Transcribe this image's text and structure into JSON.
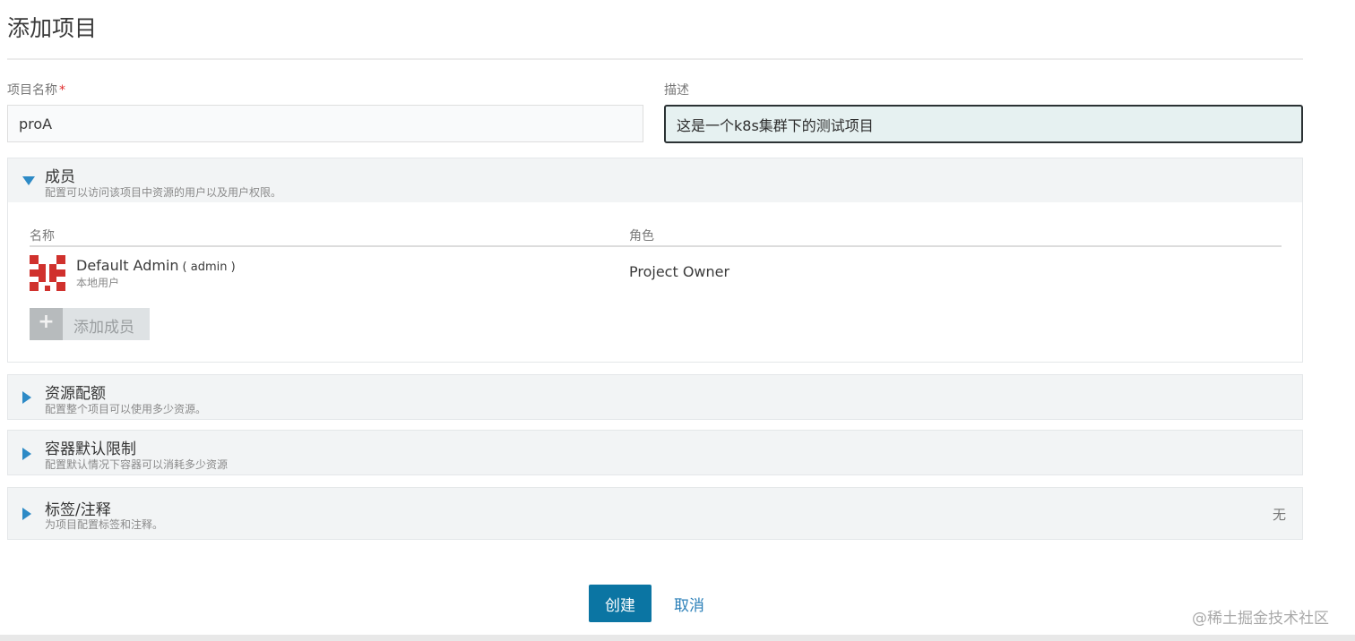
{
  "page": {
    "title": "添加项目"
  },
  "form": {
    "name_label": "项目名称",
    "required_mark": "*",
    "name_value": "proA",
    "desc_label": "描述",
    "desc_value": "这是一个k8s集群下的测试项目"
  },
  "members_section": {
    "title": "成员",
    "subtitle": "配置可以访问该项目中资源的用户以及用户权限。",
    "columns": {
      "name": "名称",
      "role": "角色"
    },
    "members": [
      {
        "display_name": "Default Admin",
        "username": "( admin )",
        "type": "本地用户",
        "role": "Project Owner"
      }
    ],
    "add_button_icon": "+",
    "add_button_label": "添加成员"
  },
  "quota_section": {
    "title": "资源配额",
    "subtitle": "配置整个项目可以使用多少资源。"
  },
  "container_limits_section": {
    "title": "容器默认限制",
    "subtitle": "配置默认情况下容器可以消耗多少资源"
  },
  "labels_section": {
    "title": "标签/注释",
    "subtitle": "为项目配置标签和注释。",
    "status": "无"
  },
  "actions": {
    "create_label": "创建",
    "cancel_label": "取消"
  },
  "watermark": "@稀土掘金技术社区",
  "colors": {
    "accent": "#0b75a3",
    "caret": "#2d8ac6",
    "avatar": "#d0312d",
    "required": "#e02a2a"
  },
  "icons": {
    "expanded": "caret-down-icon",
    "collapsed": "caret-right-icon",
    "add": "plus-icon",
    "avatar": "identicon-avatar"
  }
}
